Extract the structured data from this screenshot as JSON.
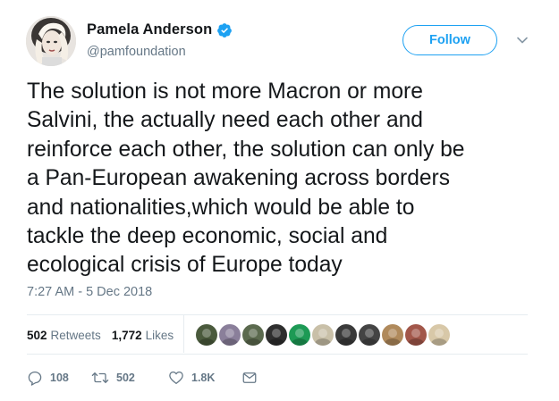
{
  "author": {
    "display_name": "Pamela Anderson",
    "handle": "@pamfoundation",
    "verified": true
  },
  "follow_button": {
    "label": "Follow"
  },
  "tweet": {
    "lines": [
      "The solution is not more Macron or more",
      "Salvini, the actually need each other and",
      "reinforce each other, the solution can only be",
      "a Pan-European awakening across borders",
      "and nationalities,which would be able to",
      "tackle the deep economic, social and",
      "ecological crisis of Europe today"
    ],
    "timestamp": "7:27 AM - 5 Dec 2018"
  },
  "stats": {
    "retweets_count": "502",
    "retweets_label": "Retweets",
    "likes_count": "1,772",
    "likes_label": "Likes"
  },
  "likers": [
    {
      "icon": "liker-avatar-1",
      "color": "#4a5a3c"
    },
    {
      "icon": "liker-avatar-2",
      "color": "#8a7f9a"
    },
    {
      "icon": "liker-avatar-3",
      "color": "#5b6a4e"
    },
    {
      "icon": "liker-avatar-4",
      "color": "#2e2e2e"
    },
    {
      "icon": "liker-avatar-5",
      "color": "#1d9a55"
    },
    {
      "icon": "liker-avatar-6",
      "color": "#c9c0a8"
    },
    {
      "icon": "liker-avatar-7",
      "color": "#3a3a3a"
    },
    {
      "icon": "liker-avatar-8",
      "color": "#444444"
    },
    {
      "icon": "liker-avatar-9",
      "color": "#b08a5c"
    },
    {
      "icon": "liker-avatar-10",
      "color": "#a2574a"
    },
    {
      "icon": "liker-avatar-11",
      "color": "#d8c8a8"
    }
  ],
  "actions": {
    "reply_count": "108",
    "retweet_count": "502",
    "like_count": "1.8K"
  },
  "colors": {
    "accent": "#1da1f2",
    "text": "#14171a",
    "secondary": "#657786",
    "divider": "#e6ecf0"
  }
}
